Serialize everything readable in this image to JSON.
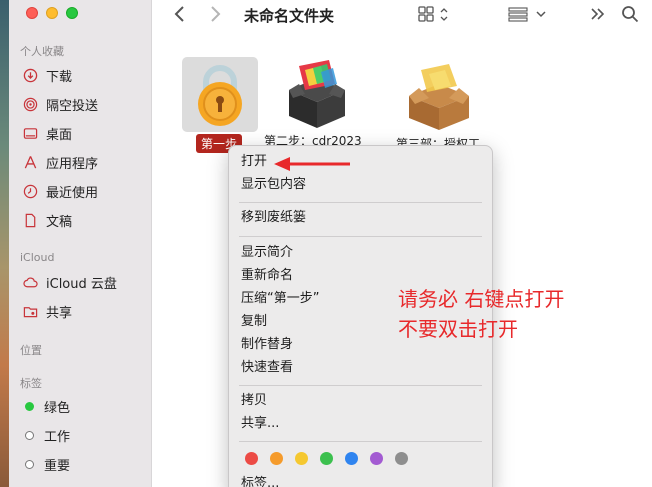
{
  "window": {
    "title": "未命名文件夹"
  },
  "sidebar": {
    "favorites_header": "个人收藏",
    "favorites": [
      {
        "label": "下载",
        "icon": "download-icon"
      },
      {
        "label": "隔空投送",
        "icon": "airdrop-icon"
      },
      {
        "label": "桌面",
        "icon": "desktop-icon"
      },
      {
        "label": "应用程序",
        "icon": "applications-icon"
      },
      {
        "label": "最近使用",
        "icon": "clock-icon"
      },
      {
        "label": "文稿",
        "icon": "document-icon"
      }
    ],
    "icloud_header": "iCloud",
    "icloud": [
      {
        "label": "iCloud 云盘",
        "icon": "cloud-icon"
      },
      {
        "label": "共享",
        "icon": "shared-folder-icon"
      }
    ],
    "locations_header": "位置",
    "tags_header": "标签",
    "tags": [
      {
        "label": "绿色",
        "color": "#28c840"
      },
      {
        "label": "工作",
        "color": "#ffffff"
      },
      {
        "label": "重要",
        "color": "#ffffff"
      }
    ]
  },
  "files": [
    {
      "label": "第一步",
      "icon": "lock-icon",
      "selected": true
    },
    {
      "label": "第二步：cdr2023",
      "icon": "package-icon"
    },
    {
      "label": "第三部：授权工",
      "icon": "box-icon"
    }
  ],
  "context_menu": {
    "group1": [
      "打开",
      "显示包内容"
    ],
    "group2": [
      "移到废纸篓"
    ],
    "group3": [
      "显示简介",
      "重新命名",
      "压缩“第一步”",
      "复制",
      "制作替身",
      "快速查看"
    ],
    "group4": [
      "拷贝",
      "共享..."
    ],
    "tag_colors": [
      "#ec4b45",
      "#f59b2b",
      "#f5c830",
      "#3cc04e",
      "#2f84ef",
      "#a35bd2",
      "#8e8e8e"
    ],
    "tags_label": "标签..."
  },
  "annotation": {
    "line1": "请务必 右键点打开",
    "line2": "不要双击打开"
  },
  "colors": {
    "accent_red": "#e8292b",
    "selection": "#b3261e"
  }
}
